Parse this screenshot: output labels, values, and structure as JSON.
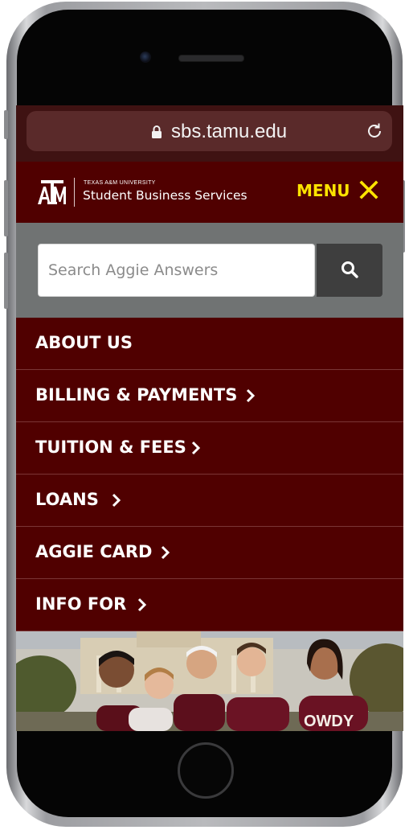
{
  "browser": {
    "url": "sbs.tamu.edu",
    "lock_icon": "lock-icon",
    "reload_icon": "reload-icon"
  },
  "header": {
    "logo_icon": "atm-logo-icon",
    "university": "TEXAS A&M UNIVERSITY",
    "site_name": "Student Business Services",
    "menu_label": "MENU",
    "close_icon": "close-icon",
    "accent_color": "#fce300",
    "brand_color": "#500000"
  },
  "search": {
    "placeholder": "Search Aggie Answers",
    "value": "",
    "button_icon": "search-icon"
  },
  "nav": {
    "items": [
      {
        "label": "ABOUT US",
        "has_submenu": false
      },
      {
        "label": "BILLING & PAYMENTS",
        "has_submenu": true
      },
      {
        "label": "TUITION & FEES",
        "has_submenu": true
      },
      {
        "label": "LOANS",
        "has_submenu": true
      },
      {
        "label": "AGGIE CARD",
        "has_submenu": true
      },
      {
        "label": "INFO FOR",
        "has_submenu": true
      }
    ]
  },
  "hero": {
    "photo": "students-group-photo"
  }
}
